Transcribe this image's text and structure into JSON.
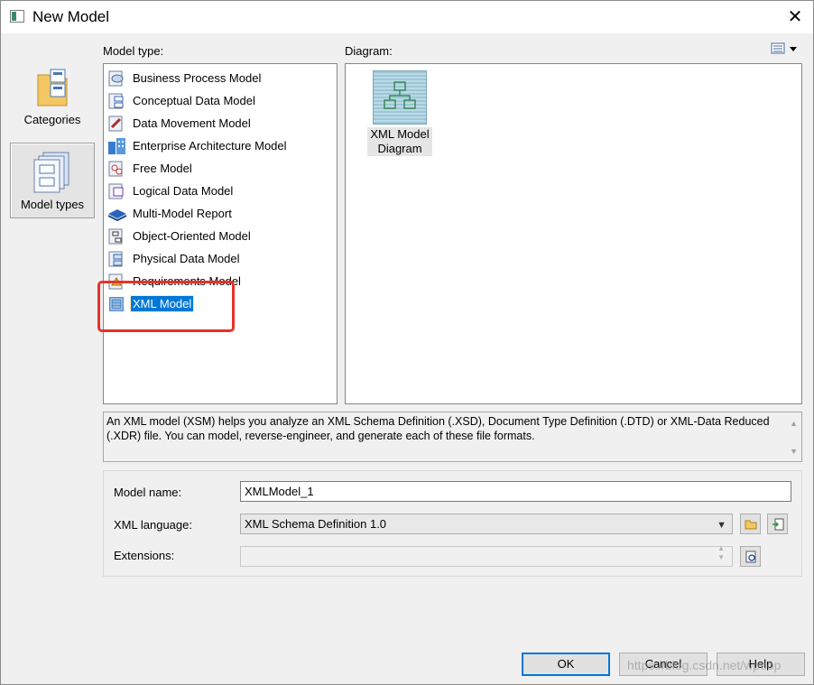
{
  "window": {
    "title": "New Model",
    "close_glyph": "✕"
  },
  "categories": [
    {
      "label": "Categories",
      "icon": "folder-categories-icon",
      "selected": false
    },
    {
      "label": "Model types",
      "icon": "model-types-icon",
      "selected": true
    }
  ],
  "model_type": {
    "label": "Model type:",
    "items": [
      {
        "label": "Business Process Model",
        "icon": "business-process-model-icon"
      },
      {
        "label": "Conceptual Data Model",
        "icon": "conceptual-data-model-icon"
      },
      {
        "label": "Data Movement Model",
        "icon": "data-movement-model-icon"
      },
      {
        "label": "Enterprise Architecture Model",
        "icon": "enterprise-architecture-model-icon"
      },
      {
        "label": "Free Model",
        "icon": "free-model-icon"
      },
      {
        "label": "Logical Data Model",
        "icon": "logical-data-model-icon"
      },
      {
        "label": "Multi-Model Report",
        "icon": "multi-model-report-icon"
      },
      {
        "label": "Object-Oriented Model",
        "icon": "object-oriented-model-icon"
      },
      {
        "label": "Physical Data Model",
        "icon": "physical-data-model-icon"
      },
      {
        "label": "Requirements Model",
        "icon": "requirements-model-icon"
      },
      {
        "label": "XML Model",
        "icon": "xml-model-icon",
        "selected": true
      }
    ]
  },
  "diagram": {
    "label": "Diagram:",
    "items": [
      {
        "line1": "XML Model",
        "line2": "Diagram",
        "icon": "xml-model-diagram-icon"
      }
    ]
  },
  "description": "An XML model (XSM) helps you analyze an XML Schema Definition (.XSD), Document Type Definition (.DTD) or XML-Data Reduced (.XDR) file. You can model, reverse-engineer, and generate each of these file formats.",
  "form": {
    "model_name_label": "Model name:",
    "model_name_value": "XMLModel_1",
    "xml_language_label": "XML language:",
    "xml_language_value": "XML Schema Definition 1.0",
    "extensions_label": "Extensions:",
    "extensions_value": ""
  },
  "buttons": {
    "ok": "OK",
    "cancel": "Cancel",
    "help": "Help"
  },
  "watermark": "https://blog.csdn.net/wpeop",
  "colors": {
    "selection": "#0078d7",
    "annotation_box": "#e8322a"
  }
}
